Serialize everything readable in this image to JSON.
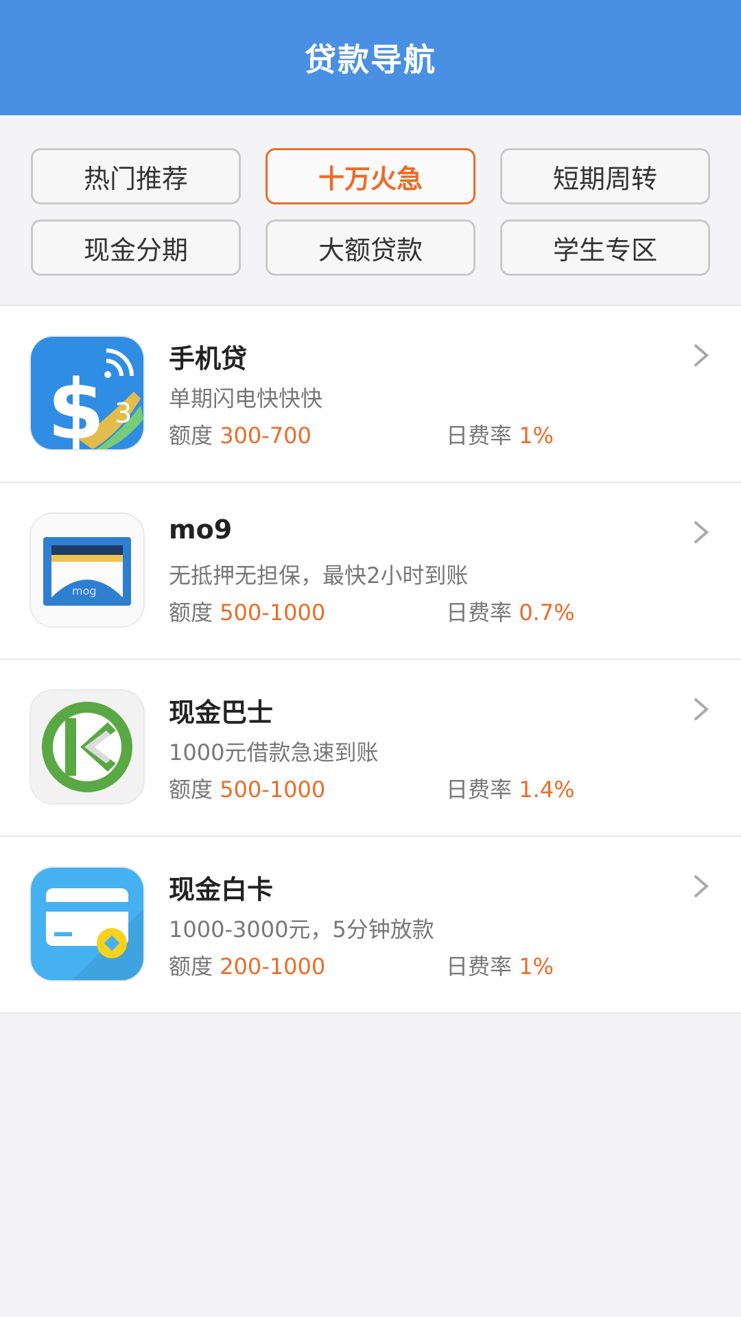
{
  "header": {
    "title": "贷款导航"
  },
  "filters": [
    {
      "label": "热门推荐",
      "active": false
    },
    {
      "label": "十万火急",
      "active": true
    },
    {
      "label": "短期周转",
      "active": false
    },
    {
      "label": "现金分期",
      "active": false
    },
    {
      "label": "大额贷款",
      "active": false
    },
    {
      "label": "学生专区",
      "active": false
    }
  ],
  "labels": {
    "quota": "额度",
    "rate": "日费率"
  },
  "colors": {
    "header": "#4a90e2",
    "accent": "#ef6a26"
  },
  "loans": [
    {
      "name": "手机贷",
      "desc": "单期闪电快快快",
      "quota": "300-700",
      "rate": "1%",
      "icon": "dollar-signal-icon"
    },
    {
      "name": "mo9",
      "desc": "无抵押无担保，最快2小时到账",
      "quota": "500-1000",
      "rate": "0.7%",
      "icon": "mo9-wallet-icon"
    },
    {
      "name": "现金巴士",
      "desc": "1000元借款急速到账",
      "quota": "500-1000",
      "rate": "1.4%",
      "icon": "cash-bus-icon"
    },
    {
      "name": "现金白卡",
      "desc": "1000-3000元，5分钟放款",
      "quota": "200-1000",
      "rate": "1%",
      "icon": "credit-card-icon"
    }
  ]
}
